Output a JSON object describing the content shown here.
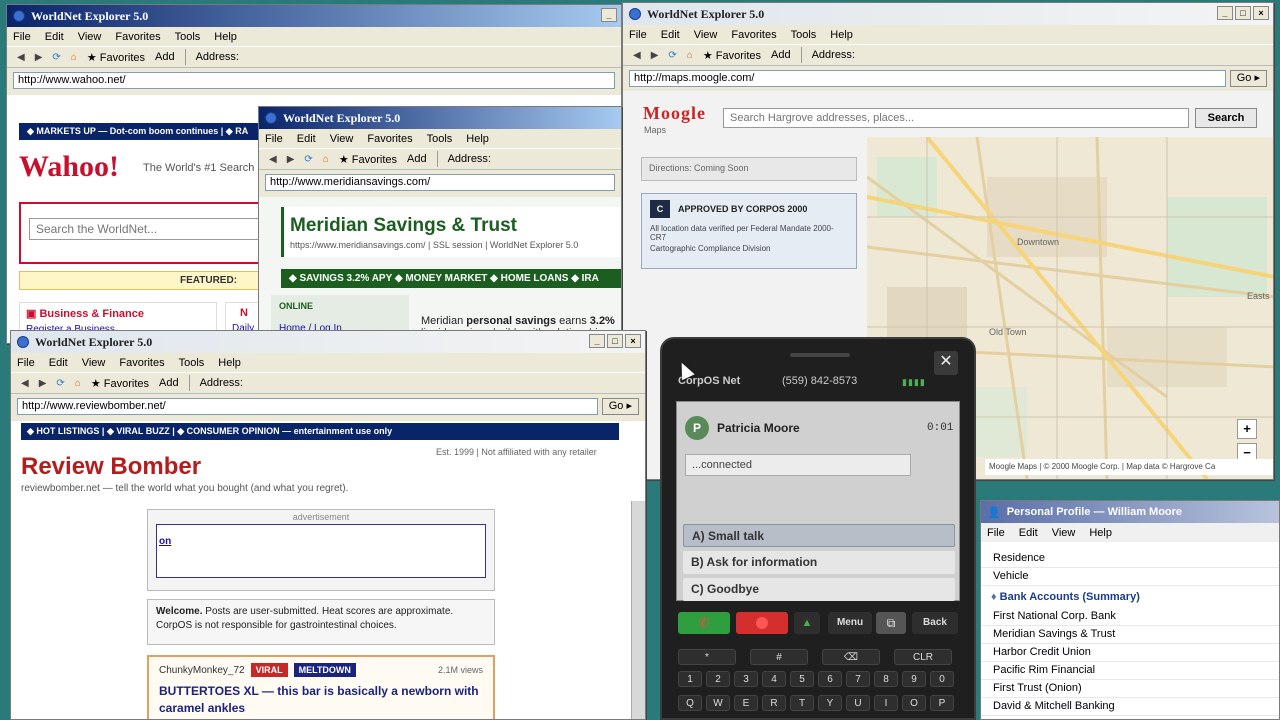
{
  "browser_common": {
    "title": "WorldNet Explorer 5.0",
    "menu": [
      "File",
      "Edit",
      "View",
      "Favorites",
      "Tools",
      "Help"
    ],
    "favorites": "★ Favorites",
    "add": "Add",
    "address_label": "Address:",
    "go": "Go ▸"
  },
  "wahoo": {
    "url": "http://www.wahoo.net/",
    "ticker": "◆ MARKETS UP — Dot-com boom continues  |  ◆ RA",
    "logo": "Wahoo!",
    "tagline": "The World's #1 Search E",
    "search_placeholder": "Search the WorldNet...",
    "featured": "FEATURED:",
    "cat_title": "Business & Finance",
    "cat_link": "Register a Business",
    "cat2_prefix": "N",
    "cat2_link": "Daily"
  },
  "meridian": {
    "url": "http://www.meridiansavings.com/",
    "title": "Meridian Savings & Trust",
    "subline": "https://www.meridiansavings.com/  |  SSL session  |  WorldNet Explorer 5.0",
    "bar": "◆ SAVINGS 3.2% APY ◆ MONEY MARKET ◆ HOME LOANS ◆ IRA",
    "online": "ONLINE",
    "home_link": "Home / Log In",
    "body_pre": "Meridian ",
    "body_bold": "personal savings",
    "body_mid": " earns ",
    "body_rate": "3.2%",
    "body_line2": "liquid; savings builds with relationship m"
  },
  "maps": {
    "url": "http://maps.moogle.com/",
    "logo": "Moogle",
    "logo_sub": "Maps",
    "search_placeholder": "Search Hargrove addresses, places...",
    "search_btn": "Search",
    "directions": "Directions: Coming Soon",
    "approved_title": "APPROVED BY CORPOS 2000",
    "approved_lines": [
      "All location data verified per Federal Mandate 2000-CR7",
      "Cartographic Compliance Division"
    ],
    "labels": [
      "Downtown",
      "Old Town",
      "Easts"
    ],
    "footer": "Moogle Maps | © 2000 Moogle Corp. | Map data © Hargrove Ca",
    "zoom_in": "+",
    "zoom_out": "−"
  },
  "review": {
    "url": "http://www.reviewbomber.net/",
    "bar": "◆ HOT LISTINGS  |  ◆ VIRAL BUZZ  |  ◆ CONSUMER OPINION — entertainment use only",
    "est": "Est. 1999  |  Not affiliated with any retailer",
    "title": "Review Bomber",
    "tagline": "reviewbomber.net — tell the world what you bought (and what you regret).",
    "ad_label": "advertisement",
    "ad_link": "on",
    "welcome_bold": "Welcome.",
    "welcome_text": " Posts are user-submitted. Heat scores are approximate. CorpOS is not responsible for gastrointestinal choices.",
    "post_user": "ChunkyMonkey_72",
    "badge_viral": "VIRAL",
    "badge_meltdown": "MELTDOWN",
    "views": "2.1M views",
    "post_title": "BUTTERTOES XL — this bar is basically a newborn with caramel ankles"
  },
  "phone": {
    "network": "CorpOS Net",
    "number": "(559) 842-8573",
    "caller": "Patricia Moore",
    "avatar": "P",
    "timer": "0:01",
    "status": "...connected",
    "options": [
      "A) Small talk",
      "B) Ask for information",
      "C) Goodbye"
    ],
    "menu": "Menu",
    "back": "Back",
    "keys_row1": [
      "*",
      "#",
      "⌫",
      "CLR"
    ],
    "keys_row2": [
      "1",
      "2",
      "3",
      "4",
      "5",
      "6",
      "7",
      "8",
      "9",
      "0"
    ],
    "keys_row3": [
      "Q",
      "W",
      "E",
      "R",
      "T",
      "Y",
      "U",
      "I",
      "O",
      "P"
    ]
  },
  "profile": {
    "title": "Personal Profile — William Moore",
    "menu": [
      "File",
      "Edit",
      "View",
      "Help"
    ],
    "rows_top": [
      "Residence",
      "Vehicle"
    ],
    "section": "Bank Accounts (Summary)",
    "banks": [
      "First National Corp. Bank",
      "Meridian Savings & Trust",
      "Harbor Credit Union",
      "Pacific Rim Financial",
      "First Trust (Onion)",
      "David & Mitchell Banking"
    ]
  },
  "colors": {
    "titlebar_active": "#0a246a",
    "wahoo_red": "#c8102e",
    "meridian_green": "#1b5e20",
    "review_red": "#b71c1c",
    "call_green": "#2e9e3e",
    "record_red": "#d32f2f"
  }
}
